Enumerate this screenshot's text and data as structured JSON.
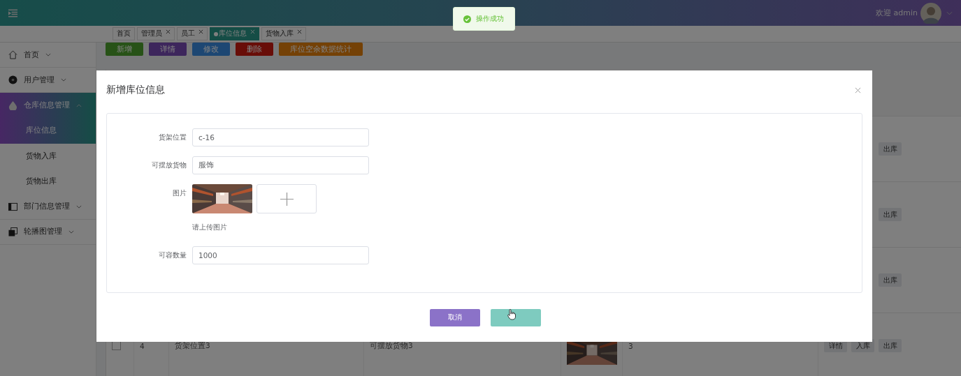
{
  "header": {
    "welcome": "欢迎 admin"
  },
  "toast": {
    "text": "操作成功"
  },
  "tabs": [
    {
      "label": "首页",
      "selected": false,
      "closable": false
    },
    {
      "label": "管理员",
      "selected": false,
      "closable": true
    },
    {
      "label": "员工",
      "selected": false,
      "closable": true
    },
    {
      "label": "库位信息",
      "selected": true,
      "closable": true
    },
    {
      "label": "货物入库",
      "selected": false,
      "closable": true
    }
  ],
  "sidebar": {
    "items": [
      {
        "label": "首页",
        "selected": false,
        "expanded": false
      },
      {
        "label": "用户管理",
        "selected": false,
        "expanded": false
      },
      {
        "label": "仓库信息管理",
        "selected": true,
        "expanded": true,
        "children": [
          {
            "label": "库位信息",
            "selected": true
          },
          {
            "label": "货物入库",
            "selected": false
          },
          {
            "label": "货物出库",
            "selected": false
          }
        ]
      },
      {
        "label": "部门信息管理",
        "selected": false,
        "expanded": false
      },
      {
        "label": "轮播图管理",
        "selected": false,
        "expanded": false
      }
    ]
  },
  "toolbar": {
    "buttons": [
      {
        "label": "新增",
        "kind": "add"
      },
      {
        "label": "详情",
        "kind": "detail"
      },
      {
        "label": "修改",
        "kind": "edit"
      },
      {
        "label": "删除",
        "kind": "delete"
      },
      {
        "label": "库位空余数据统计",
        "kind": "stats"
      }
    ]
  },
  "table": {
    "rows": [
      {
        "actions": [
          {
            "kind": "out",
            "label": "出库"
          }
        ]
      },
      {
        "actions": [
          {
            "kind": "out",
            "label": "出库"
          }
        ]
      },
      {
        "actions": [
          {
            "kind": "out",
            "label": "出库"
          }
        ]
      },
      {
        "checked": false,
        "index": "4",
        "location": "货架位置3",
        "goods": "可摆放货物3",
        "image": {
          "kind": "picture"
        },
        "quantity": "3",
        "actions": [
          {
            "kind": "detail",
            "label": "详情"
          },
          {
            "kind": "in",
            "label": "入库"
          },
          {
            "kind": "out",
            "label": "出库"
          }
        ]
      }
    ]
  },
  "dialog": {
    "title": "新增库位信息",
    "fields": [
      {
        "kind": "text",
        "label": "货架位置",
        "value": "c-16"
      },
      {
        "kind": "text",
        "label": "可摆放货物",
        "value": "服饰"
      },
      {
        "kind": "upload",
        "label": "图片",
        "hint": "请上传图片"
      },
      {
        "kind": "text",
        "label": "可容数量",
        "value": "1000"
      }
    ],
    "buttons": [
      {
        "kind": "cancel",
        "label": "取消"
      },
      {
        "kind": "confirm"
      }
    ]
  }
}
